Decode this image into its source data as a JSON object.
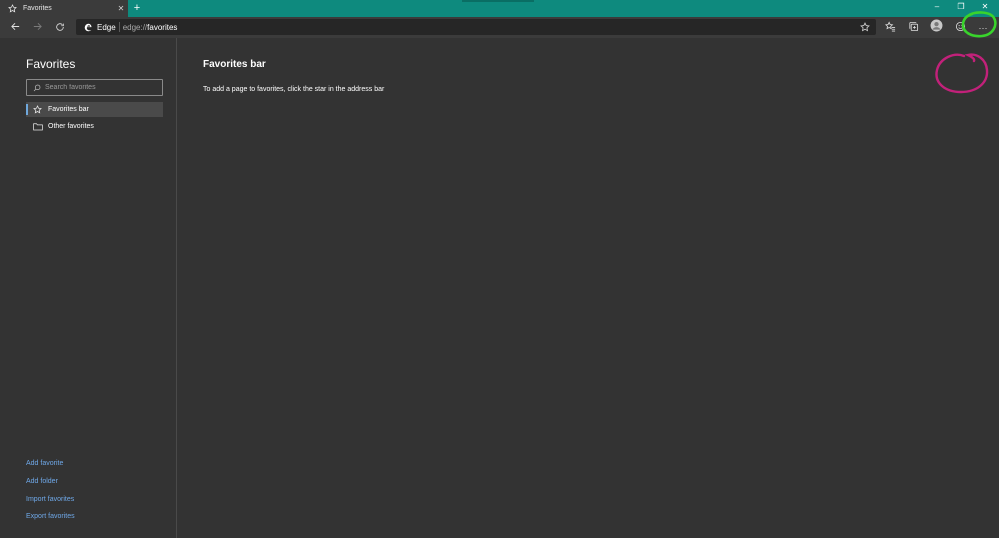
{
  "tab": {
    "title": "Favorites",
    "close_glyph": "✕",
    "icon": "star-icon"
  },
  "new_tab_glyph": "+",
  "window_controls": {
    "minimize": "–",
    "restore": "❐",
    "close": "✕"
  },
  "address": {
    "site_label": "Edge",
    "url_scheme": "edge://",
    "url_path": "favorites"
  },
  "toolbar": {
    "more_glyph": "···"
  },
  "sidebar": {
    "title": "Favorites",
    "search_placeholder": "Search favorites",
    "items": [
      {
        "label": "Favorites bar",
        "icon": "star-icon",
        "active": true
      },
      {
        "label": "Other favorites",
        "icon": "folder-icon",
        "active": false
      }
    ],
    "links": [
      {
        "label": "Add favorite"
      },
      {
        "label": "Add folder"
      },
      {
        "label": "Import favorites"
      },
      {
        "label": "Export favorites"
      }
    ]
  },
  "main": {
    "title": "Favorites bar",
    "hint": "To add a page to favorites, click the star in the address bar"
  },
  "colors": {
    "titlebar": "#0e8a7e",
    "background": "#333333",
    "toolbar": "#3b3b3b",
    "link": "#6fa8e8",
    "annotation_green": "#39d42c",
    "annotation_magenta": "#c2217a"
  }
}
